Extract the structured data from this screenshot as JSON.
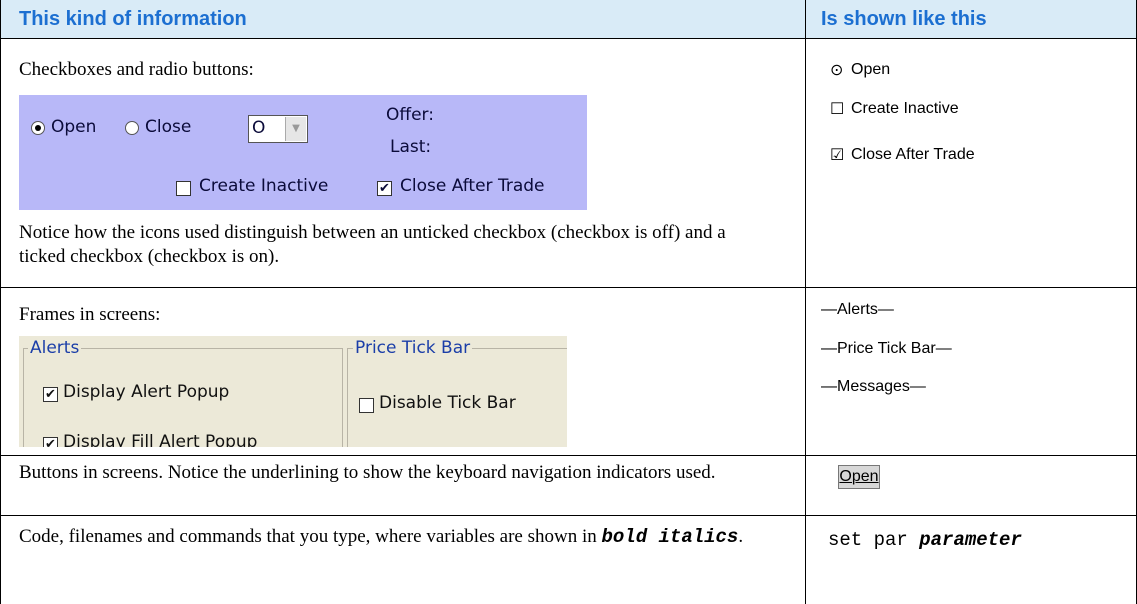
{
  "header": {
    "col1": "This kind of information",
    "col2": "Is shown like this"
  },
  "rows": {
    "checkboxes": {
      "title": "Checkboxes and radio buttons:",
      "note": "Notice how the icons used distinguish between an unticked checkbox (checkbox is off) and a ticked checkbox (checkbox is on).",
      "shown": {
        "open": "Open",
        "create_inactive": "Create Inactive",
        "close_after_trade": "Close After Trade"
      },
      "screenshot": {
        "radio_open": "Open",
        "radio_close": "Close",
        "combo_value": "O",
        "offer_label": "Offer:",
        "last_label": "Last:",
        "cb_create_inactive": "Create Inactive",
        "cb_close_after_trade": "Close After Trade"
      }
    },
    "frames": {
      "title": "Frames in screens:",
      "shown": [
        "—Alerts—",
        "—Price Tick Bar—",
        "—Messages—"
      ],
      "screenshot": {
        "frame1_legend": "Alerts",
        "frame2_legend": "Price Tick Bar",
        "cb_display_alert": "Display Alert Popup",
        "cb_display_fill": "Display Fill Alert Popup",
        "cb_disable_tick": "Disable Tick Bar"
      }
    },
    "buttons": {
      "title": "Buttons in screens. Notice the underlining to show the keyboard navigation indicators used.",
      "button_label": "Open"
    },
    "code": {
      "title_prefix": "Code, filenames and commands that you type, where variables are shown in",
      "title_emph": "bold italics",
      "title_suffix": ".",
      "code_plain": "set par",
      "code_var": "parameter"
    }
  }
}
